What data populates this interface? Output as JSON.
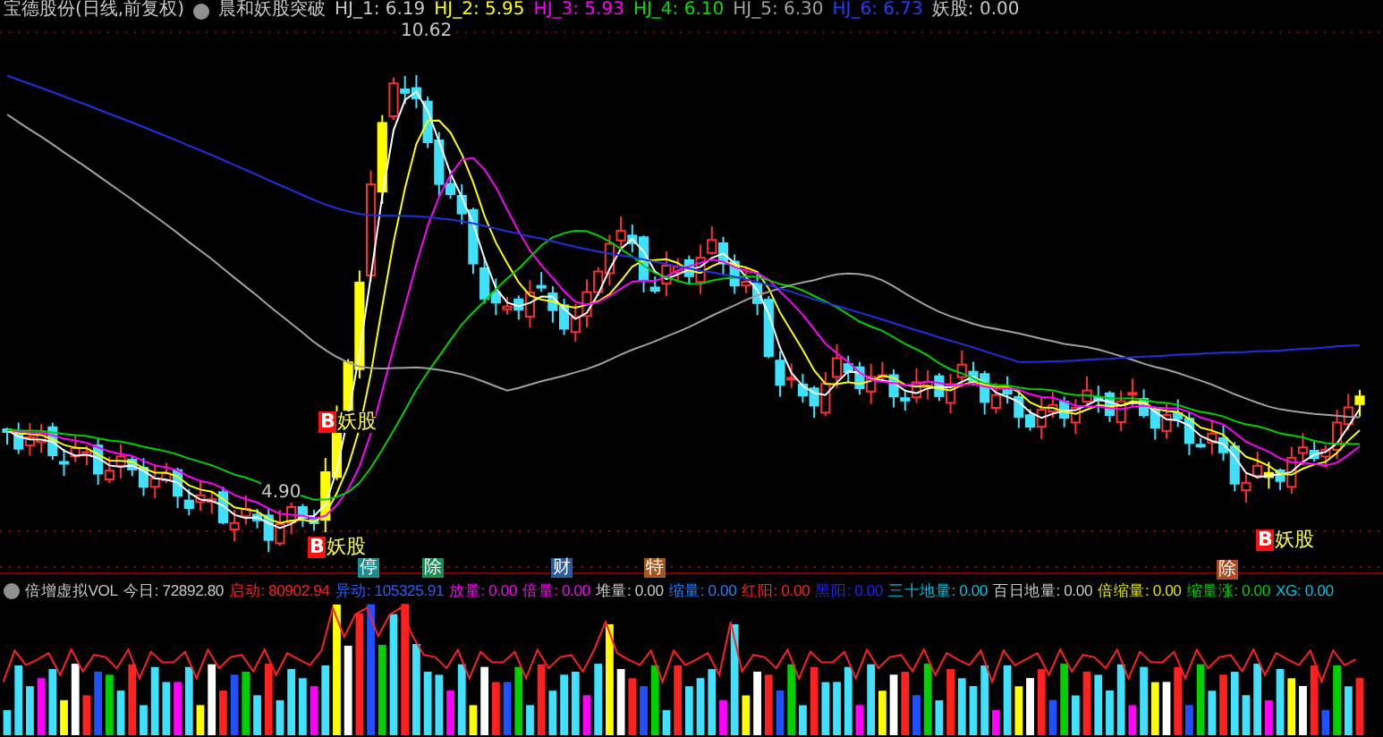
{
  "header": {
    "title": "宝德股份(日线,前复权)",
    "indicator": "晨和妖股突破",
    "values": [
      {
        "text": "HJ_1: 6.19",
        "color": "#c8c8c8"
      },
      {
        "text": "HJ_2: 5.95",
        "color": "#ffff00"
      },
      {
        "text": "HJ_3: 5.93",
        "color": "#ff00ff"
      },
      {
        "text": "HJ_4: 6.10",
        "color": "#00e000"
      },
      {
        "text": "HJ_5: 6.30",
        "color": "#a0a0a0"
      },
      {
        "text": "HJ_6: 6.73",
        "color": "#2040ff"
      }
    ],
    "extra": "妖股: 0.00"
  },
  "price_labels": [
    {
      "text": "10.62"
    },
    {
      "text": "4.90"
    }
  ],
  "signals": [
    {
      "mark": "B",
      "label": "妖股"
    },
    {
      "mark": "B",
      "label": "妖股"
    },
    {
      "mark": "B",
      "label": "妖股"
    }
  ],
  "events": [
    {
      "text": "停",
      "color": "#1e8c8c"
    },
    {
      "text": "除",
      "color": "#1e8c5a"
    },
    {
      "text": "财",
      "color": "#2a5aa0"
    },
    {
      "text": "特",
      "color": "#a05a20"
    },
    {
      "text": "除",
      "color": "#b04a20"
    }
  ],
  "volume_legend": {
    "title": "倍增虚拟VOL",
    "items": [
      {
        "text": "今日: 72892.80",
        "color": "#c8c8c8"
      },
      {
        "text": "启动: 80902.94",
        "color": "#ff2020"
      },
      {
        "text": "异动: 105325.91",
        "color": "#2060ff"
      },
      {
        "text": "放量: 0.00",
        "color": "#ff00ff"
      },
      {
        "text": "倍量: 0.00",
        "color": "#ff00ff"
      },
      {
        "text": "堆量: 0.00",
        "color": "#c8c8c8"
      },
      {
        "text": "缩量: 0.00",
        "color": "#2080ff"
      },
      {
        "text": "红阳: 0.00",
        "color": "#ff2020"
      },
      {
        "text": "黑阳: 0.00",
        "color": "#2020ff"
      },
      {
        "text": "三十地量: 0.00",
        "color": "#00c0e0"
      },
      {
        "text": "百日地量: 0.00",
        "color": "#c8c8c8"
      },
      {
        "text": "倍缩量: 0.00",
        "color": "#e0e000"
      },
      {
        "text": "缩量涨: 0.00",
        "color": "#00d000"
      },
      {
        "text": "XG: 0.00",
        "color": "#00c0e0"
      }
    ]
  }
}
